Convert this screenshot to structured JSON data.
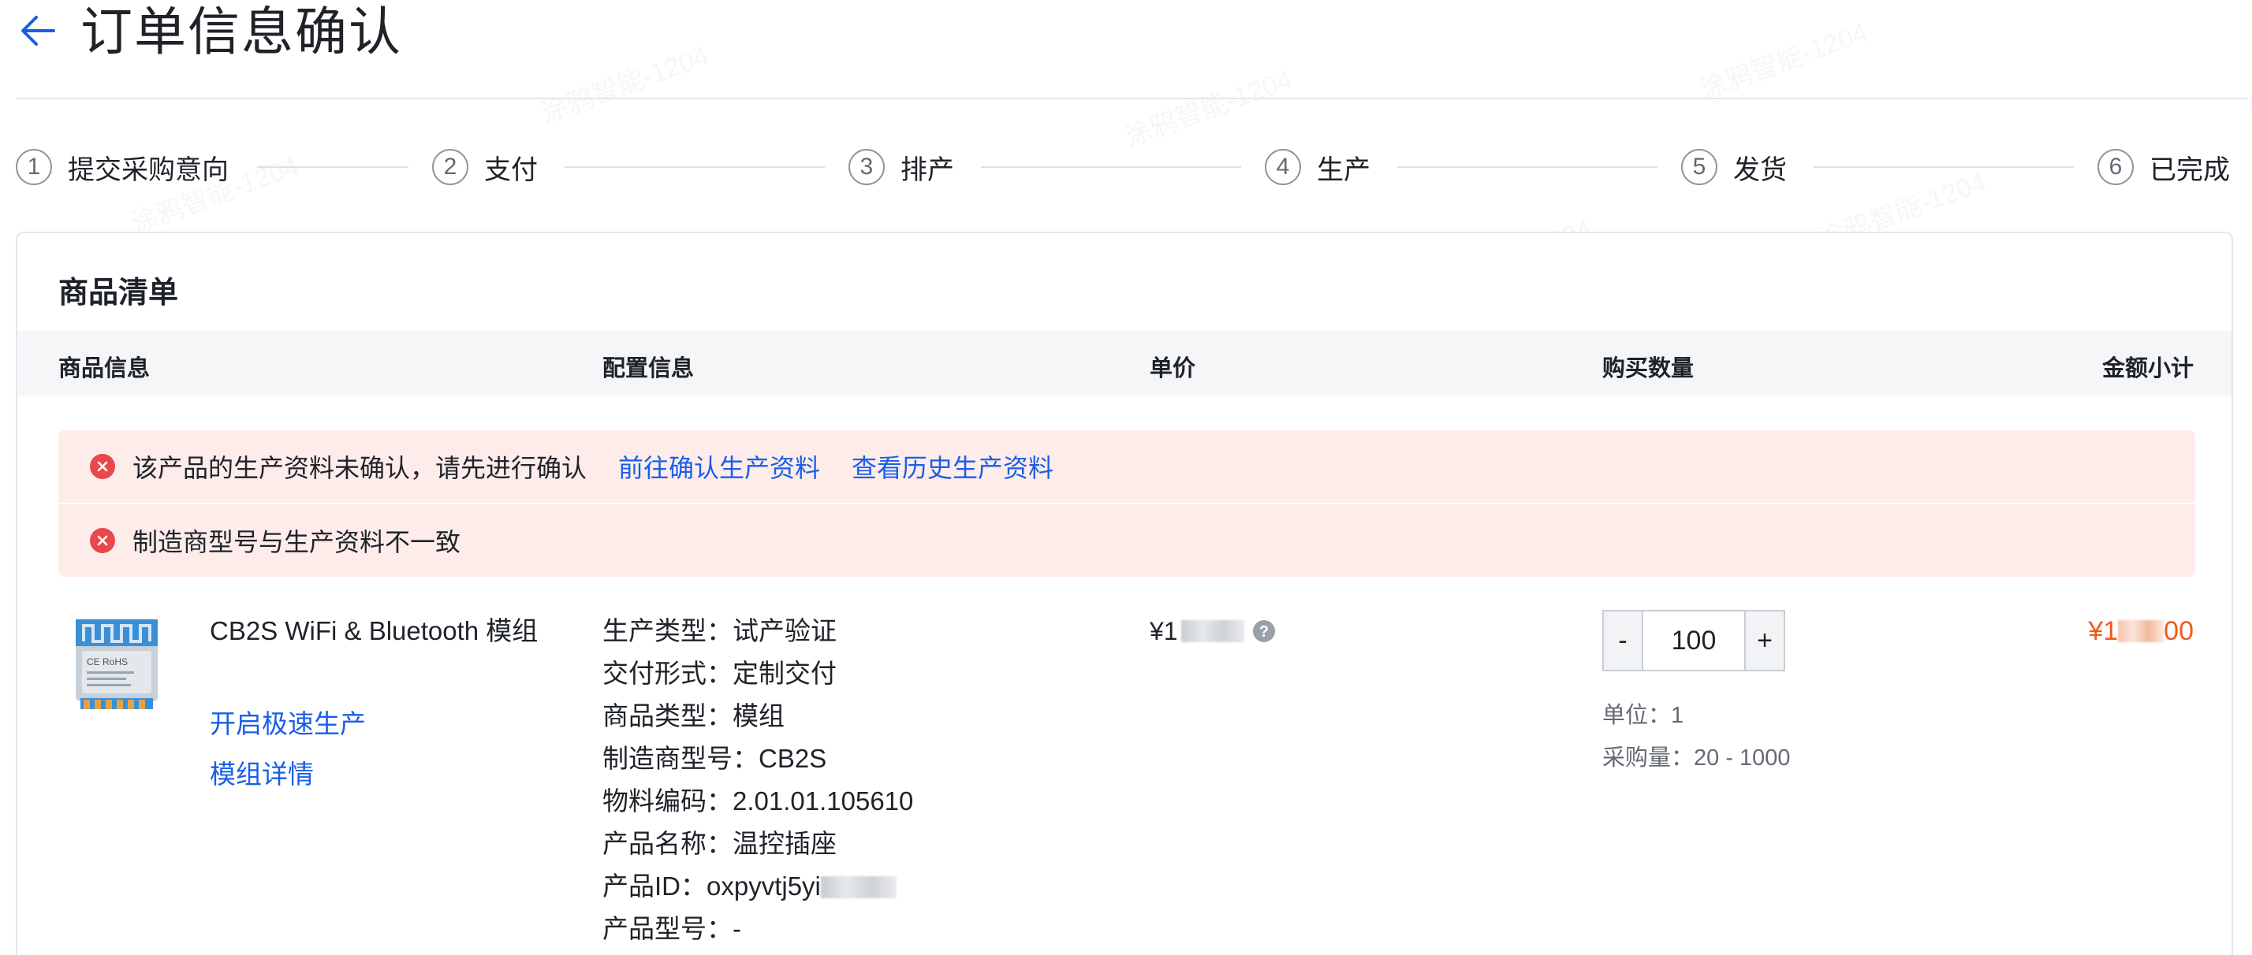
{
  "header": {
    "title": "订单信息确认",
    "back_icon": "arrow-left-icon"
  },
  "steps": [
    {
      "num": "1",
      "label": "提交采购意向"
    },
    {
      "num": "2",
      "label": "支付"
    },
    {
      "num": "3",
      "label": "排产"
    },
    {
      "num": "4",
      "label": "生产"
    },
    {
      "num": "5",
      "label": "发货"
    },
    {
      "num": "6",
      "label": "已完成"
    }
  ],
  "card": {
    "title": "商品清单",
    "columns": {
      "product": "商品信息",
      "config": "配置信息",
      "price": "单价",
      "quantity": "购买数量",
      "subtotal": "金额小计"
    }
  },
  "alerts": [
    {
      "text": "该产品的生产资料未确认，请先进行确认",
      "links": [
        "前往确认生产资料",
        "查看历史生产资料"
      ]
    },
    {
      "text": "制造商型号与生产资料不一致"
    }
  ],
  "product": {
    "name": "CB2S WiFi & Bluetooth 模组",
    "link_fast": "开启极速生产",
    "link_detail": "模组详情",
    "config": [
      {
        "label": "生产类型：",
        "value": "试产验证"
      },
      {
        "label": "交付形式：",
        "value": "定制交付"
      },
      {
        "label": "商品类型：",
        "value": "模组"
      },
      {
        "label": "制造商型号：",
        "value": "CB2S"
      },
      {
        "label": "物料编码：",
        "value": "2.01.01.105610"
      },
      {
        "label": "产品名称：",
        "value": "温控插座"
      },
      {
        "label": "产品ID：",
        "value": "oxpyvtj5yi"
      },
      {
        "label": "产品型号：",
        "value": "-"
      }
    ],
    "price_prefix": "¥1",
    "quantity": {
      "minus": "-",
      "plus": "+",
      "value": "100"
    },
    "unit": "单位：1",
    "range": "采购量：20 - 1000",
    "subtotal_prefix": "¥1",
    "subtotal_suffix": "00"
  },
  "watermark": "涂鸦智能-1204",
  "colors": {
    "link": "#1a5ee8",
    "error": "#e8474b",
    "alert_bg": "#fdecea",
    "price": "#f25a1a"
  }
}
